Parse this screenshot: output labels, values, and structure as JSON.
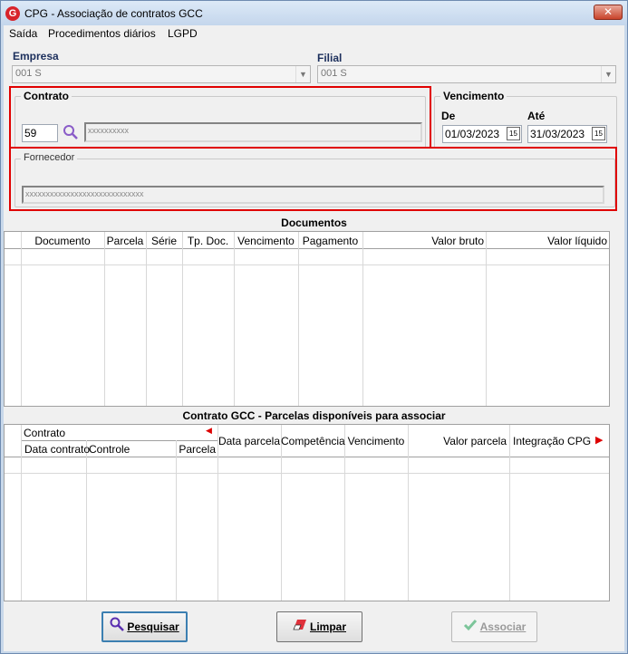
{
  "window": {
    "title": "CPG - Associação de contratos GCC",
    "close_glyph": "✕",
    "app_icon_letter": "G"
  },
  "menu": {
    "items": [
      "Saída",
      "Procedimentos diários",
      "LGPD"
    ]
  },
  "empresa": {
    "label": "Empresa",
    "value": "001 S"
  },
  "filial": {
    "label": "Filial",
    "value": "001 S"
  },
  "contrato": {
    "group_label": "Contrato",
    "code": "59",
    "description": "xxxxxxxxxx"
  },
  "vencimento": {
    "group_label": "Vencimento",
    "de_label": "De",
    "de_value": "01/03/2023",
    "ate_label": "Até",
    "ate_value": "31/03/2023",
    "cal_glyph": "15"
  },
  "fornecedor": {
    "group_label": "Fornecedor",
    "value": "xxxxxxxxxxxxxxxxxxxxxxxxxxxxx"
  },
  "documentos": {
    "title": "Documentos",
    "columns": [
      "Documento",
      "Parcela",
      "Série",
      "Tp. Doc.",
      "Vencimento",
      "Pagamento",
      "Valor bruto",
      "Valor líquido"
    ]
  },
  "parcelas": {
    "title": "Contrato GCC - Parcelas disponíveis para associar",
    "group_header": "Contrato",
    "sub_columns": [
      "Data contrato",
      "Controle",
      "Parcela"
    ],
    "columns": [
      "Data parcela",
      "Competência",
      "Vencimento",
      "Valor parcela",
      "Integração CPG"
    ]
  },
  "buttons": {
    "pesquisar": "Pesquisar",
    "limpar": "Limpar",
    "associar": "Associar"
  },
  "colors": {
    "highlight": "#e00000",
    "accent": "#3c7fb1"
  }
}
